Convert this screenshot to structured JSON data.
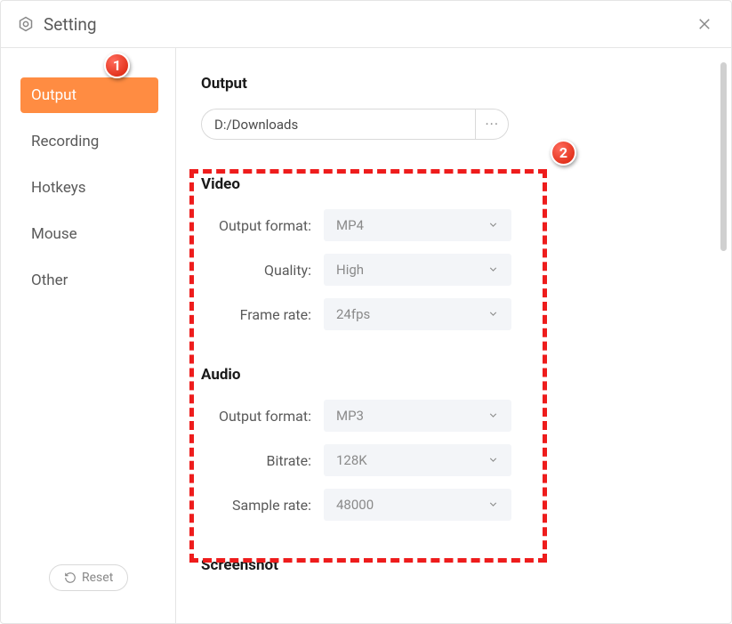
{
  "title": "Setting",
  "sidebar": {
    "items": [
      {
        "label": "Output",
        "active": true
      },
      {
        "label": "Recording",
        "active": false
      },
      {
        "label": "Hotkeys",
        "active": false
      },
      {
        "label": "Mouse",
        "active": false
      },
      {
        "label": "Other",
        "active": false
      }
    ],
    "reset_label": "Reset"
  },
  "content": {
    "output": {
      "title": "Output",
      "path": "D:/Downloads"
    },
    "video": {
      "title": "Video",
      "output_format": {
        "label": "Output format:",
        "value": "MP4"
      },
      "quality": {
        "label": "Quality:",
        "value": "High"
      },
      "frame_rate": {
        "label": "Frame rate:",
        "value": "24fps"
      }
    },
    "audio": {
      "title": "Audio",
      "output_format": {
        "label": "Output format:",
        "value": "MP3"
      },
      "bitrate": {
        "label": "Bitrate:",
        "value": "128K"
      },
      "sample_rate": {
        "label": "Sample rate:",
        "value": "48000"
      }
    },
    "screenshot": {
      "title": "Screenshot"
    }
  },
  "annotations": {
    "badge1": "1",
    "badge2": "2"
  }
}
